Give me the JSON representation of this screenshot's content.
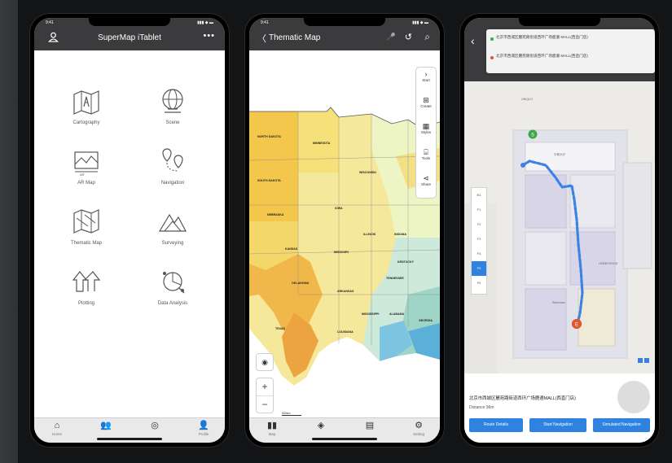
{
  "phones": {
    "left": {
      "status_time": "9:41",
      "status_icons": "▮▮▮ ◆ ▬",
      "title": "SuperMap iTablet",
      "menu_icon": "more-icon",
      "more_glyph": "•••",
      "modules": [
        {
          "label": "Cartography",
          "icon": "cartography-icon"
        },
        {
          "label": "Scene",
          "icon": "scene-globe-icon"
        },
        {
          "label": "AR Map",
          "icon": "ar-map-icon"
        },
        {
          "label": "Navigation",
          "icon": "navigation-icon"
        },
        {
          "label": "Thematic Map",
          "icon": "thematic-map-icon"
        },
        {
          "label": "Surveying",
          "icon": "surveying-icon"
        },
        {
          "label": "Plotting",
          "icon": "plotting-icon"
        },
        {
          "label": "Data Analysis",
          "icon": "data-analysis-icon"
        }
      ],
      "tabs": [
        {
          "label": "Home",
          "icon": "home-icon",
          "glyph": "⌂"
        },
        {
          "label": "",
          "icon": "friends-icon",
          "glyph": "👥"
        },
        {
          "label": "",
          "icon": "discover-icon",
          "glyph": "◎"
        },
        {
          "label": "Profile",
          "icon": "profile-icon",
          "glyph": "👤"
        }
      ]
    },
    "middle": {
      "status_time": "9:41",
      "status_icons": "▮▮▮ ◆ ▬",
      "title": "Thematic Map",
      "back_glyph": "〈",
      "top_icons": [
        "🎤",
        "↺",
        "⌕"
      ],
      "map_labels": [
        "NORTH DAKOTA",
        "MINNESOTA",
        "SOUTH DAKOTA",
        "WISCONSIN",
        "IOWA",
        "NEBRASKA",
        "ILLINOIS",
        "INDIANA",
        "KANSAS",
        "MISSOURI",
        "KENTUCKY",
        "OKLAHOMA",
        "ARKANSAS",
        "TENNESSEE",
        "TEXAS",
        "LOUISIANA",
        "MISSISSIPPI",
        "ALABAMA",
        "GEORGIA"
      ],
      "tools": [
        {
          "label": "Start",
          "icon": "start-icon",
          "glyph": "›"
        },
        {
          "label": "Create",
          "icon": "create-icon",
          "glyph": "⊞"
        },
        {
          "label": "Styles",
          "icon": "styles-icon",
          "glyph": "▦"
        },
        {
          "label": "Tools",
          "icon": "tools-icon",
          "glyph": "⌸"
        },
        {
          "label": "Share",
          "icon": "share-icon",
          "glyph": "⋖"
        }
      ],
      "locate_glyph": "◉",
      "zoom_in": "+",
      "zoom_out": "−",
      "scale_text": "500km",
      "tabs": [
        {
          "label": "Map",
          "icon": "map-book-icon",
          "glyph": "▮▮"
        },
        {
          "label": "",
          "icon": "layers-icon",
          "glyph": "◈"
        },
        {
          "label": "",
          "icon": "attribute-icon",
          "glyph": "▤"
        },
        {
          "label": "Setting",
          "icon": "settings-icon",
          "glyph": "⚙"
        }
      ]
    },
    "right": {
      "back_glyph": "‹",
      "route_from": "北京市西城区麓苑路街道西环广场鹿遵 MALL(西直门店)",
      "route_to": "北京市西城区麓苑路街道西环广场鹿遵 MALL(西直门店)",
      "floors": [
        "B1",
        "F1",
        "F2",
        "F3",
        "F4",
        "F5",
        "F6"
      ],
      "active_floor": "F5",
      "room_labels": [
        "UNIQLO",
        "平和大厅",
        "Starbucks",
        "HOBBYHOOD"
      ],
      "destination_title": "北京市西城区麓苑路街道西环广场鹿遵MALL(西直门店)",
      "distance": "Distance 96m",
      "buttons": [
        "Route Details",
        "Start Navigation",
        "Simulated Navigation"
      ],
      "colors": {
        "route": "#3b82e6",
        "start": "#3aa648",
        "end": "#e0572f"
      }
    }
  }
}
